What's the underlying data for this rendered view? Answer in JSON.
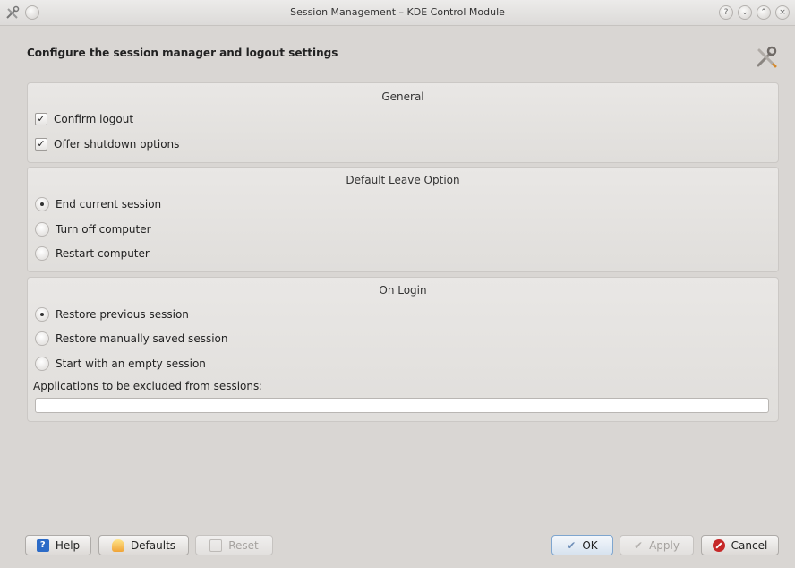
{
  "window": {
    "title": "Session Management – KDE Control Module",
    "controls": [
      "help-icon",
      "minimize-icon",
      "maximize-icon",
      "close-icon"
    ]
  },
  "header": {
    "text": "Configure the session manager and logout settings",
    "icon": "tools-icon"
  },
  "general": {
    "title": "General",
    "confirm_logout": {
      "label": "Confirm logout",
      "checked": true
    },
    "offer_shutdown": {
      "label": "Offer shutdown options",
      "checked": true
    }
  },
  "default_leave": {
    "title": "Default Leave Option",
    "options": [
      {
        "label": "End current session",
        "selected": true
      },
      {
        "label": "Turn off computer",
        "selected": false
      },
      {
        "label": "Restart computer",
        "selected": false
      }
    ]
  },
  "on_login": {
    "title": "On Login",
    "options": [
      {
        "label": "Restore previous session",
        "selected": true
      },
      {
        "label": "Restore manually saved session",
        "selected": false
      },
      {
        "label": "Start with an empty session",
        "selected": false
      }
    ],
    "excluded_label": "Applications to be excluded from sessions:",
    "excluded_value": ""
  },
  "buttons": {
    "help": "Help",
    "defaults": "Defaults",
    "reset": "Reset",
    "ok": "OK",
    "apply": "Apply",
    "cancel": "Cancel"
  },
  "colors": {
    "background": "#d9d6d3",
    "cancel_icon": "#c62828",
    "help_icon": "#2c6bc7"
  }
}
